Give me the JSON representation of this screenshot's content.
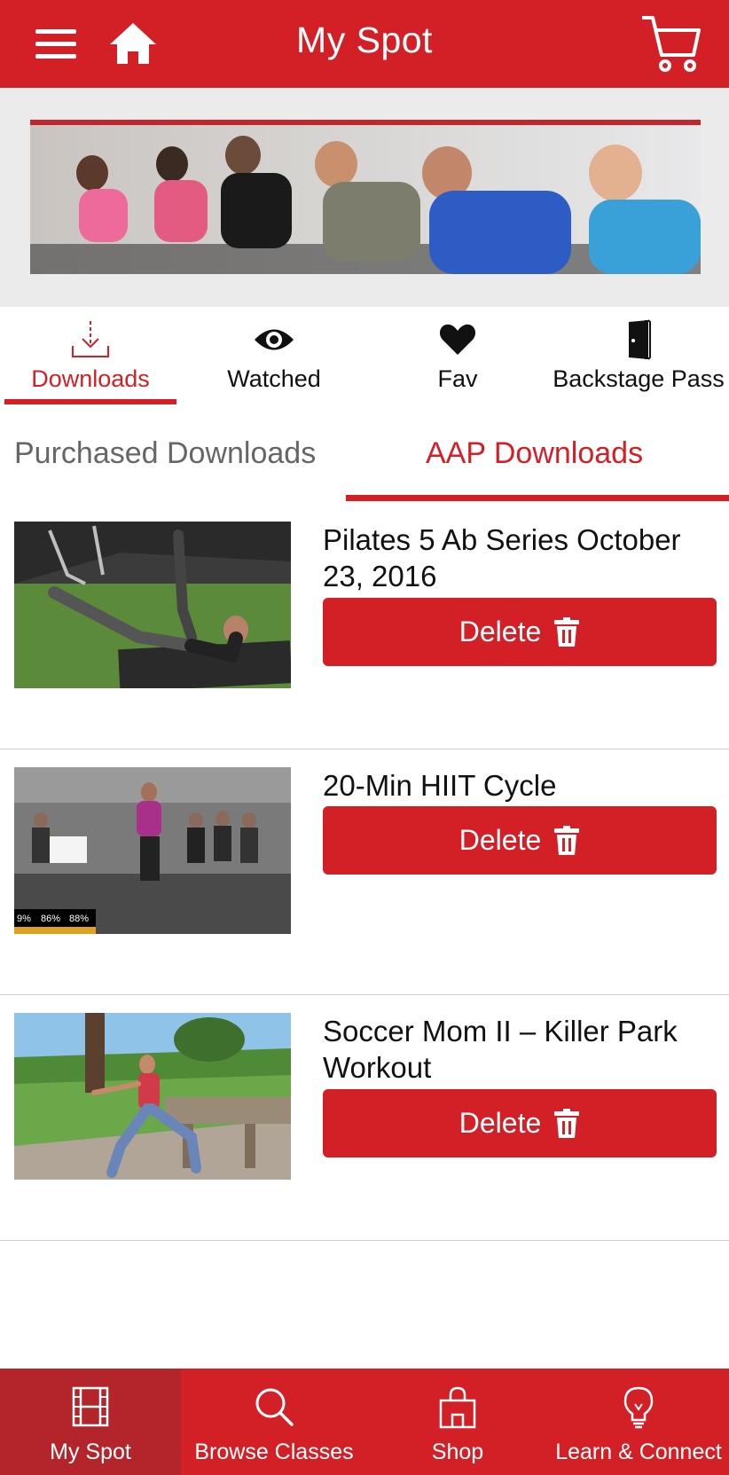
{
  "header": {
    "title": "My Spot",
    "menu_icon": "hamburger-menu-icon",
    "home_icon": "home-icon",
    "cart_icon": "shopping-cart-icon"
  },
  "banner": {
    "description_icon": "cycling-class-photo"
  },
  "section_tabs": [
    {
      "label": "Downloads",
      "icon": "download-icon",
      "active": true
    },
    {
      "label": "Watched",
      "icon": "eye-icon",
      "active": false
    },
    {
      "label": "Fav",
      "icon": "heart-icon",
      "active": false
    },
    {
      "label": "Backstage Pass",
      "icon": "door-icon",
      "active": false
    }
  ],
  "sub_tabs": [
    {
      "label": "Purchased Downloads",
      "active": false
    },
    {
      "label": "AAP Downloads",
      "active": true
    }
  ],
  "downloads": [
    {
      "title": "Pilates 5 Ab Series October 23, 2016",
      "delete_label": "Delete"
    },
    {
      "title": "20-Min HIIT Cycle",
      "delete_label": "Delete",
      "overlay_stats": [
        "9%",
        "86%",
        "88%"
      ]
    },
    {
      "title": "Soccer Mom II – Killer Park Workout",
      "delete_label": "Delete"
    }
  ],
  "bottom_nav": [
    {
      "label": "My Spot",
      "icon": "film-icon",
      "active": true
    },
    {
      "label": "Browse Classes",
      "icon": "search-icon",
      "active": false
    },
    {
      "label": "Shop",
      "icon": "shopping-bag-icon",
      "active": false
    },
    {
      "label": "Learn & Connect",
      "icon": "lightbulb-icon",
      "active": false
    }
  ],
  "colors": {
    "brand_red": "#d32027",
    "banner_bg": "#ebebec",
    "divider": "#cfcfcf"
  }
}
